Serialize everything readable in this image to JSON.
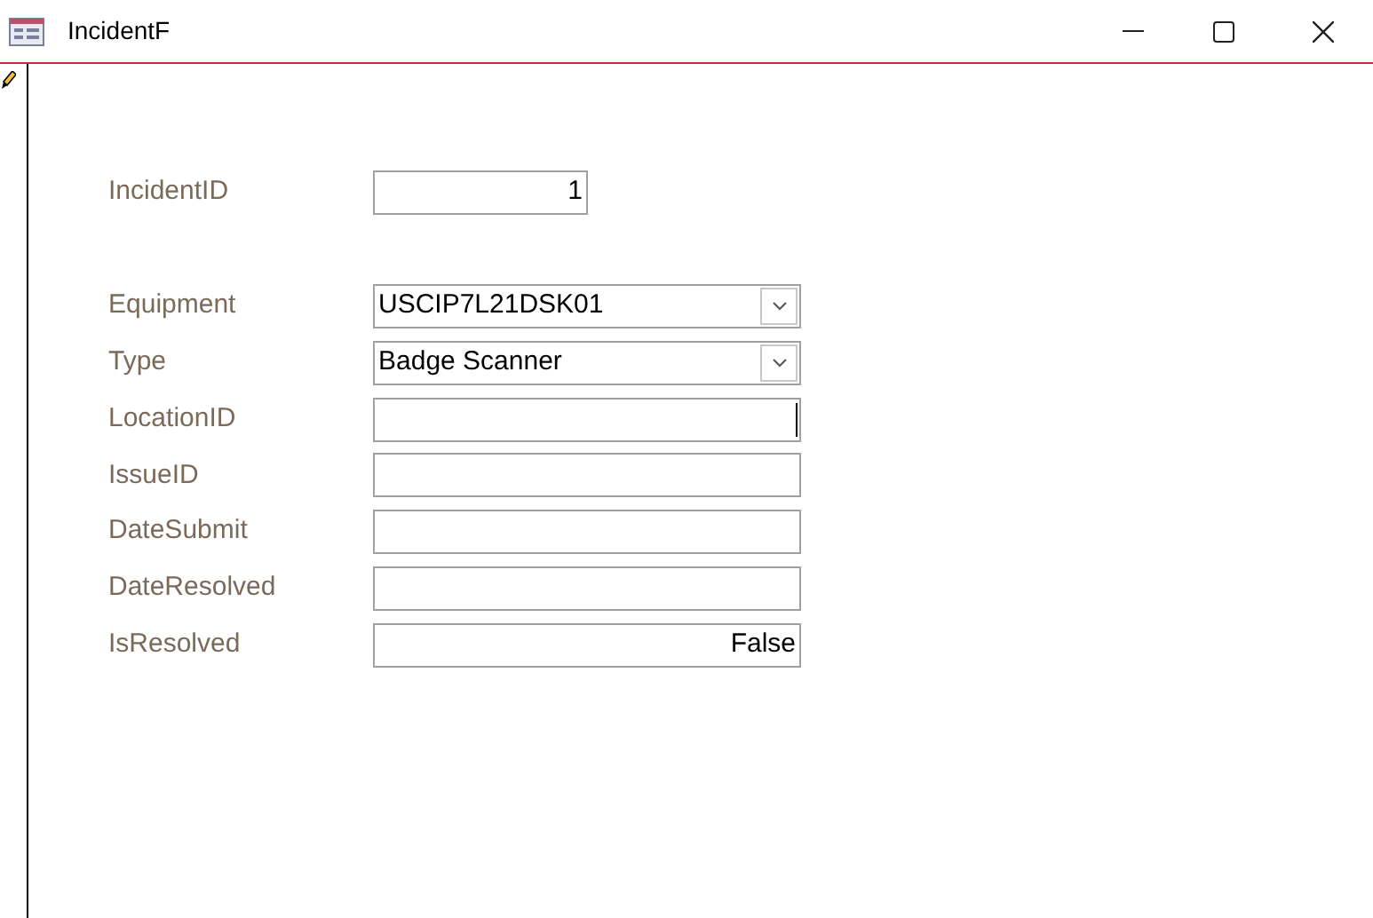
{
  "window": {
    "title": "IncidentF"
  },
  "key_field": {
    "label": "IncidentID",
    "value": "1",
    "kind": "number"
  },
  "fields": [
    {
      "label": "Equipment",
      "value": "USCIP7L21DSK01",
      "kind": "combo",
      "focused": false
    },
    {
      "label": "Type",
      "value": "Badge Scanner",
      "kind": "combo",
      "focused": false
    },
    {
      "label": "LocationID",
      "kind": "text",
      "focused": true
    },
    {
      "label": "IssueID",
      "kind": "text",
      "focused": false
    },
    {
      "label": "DateSubmit",
      "kind": "text",
      "focused": false
    },
    {
      "label": "DateResolved",
      "kind": "text",
      "focused": false
    },
    {
      "label": "IsResolved",
      "value": "False",
      "kind": "boolean",
      "focused": false
    }
  ]
}
